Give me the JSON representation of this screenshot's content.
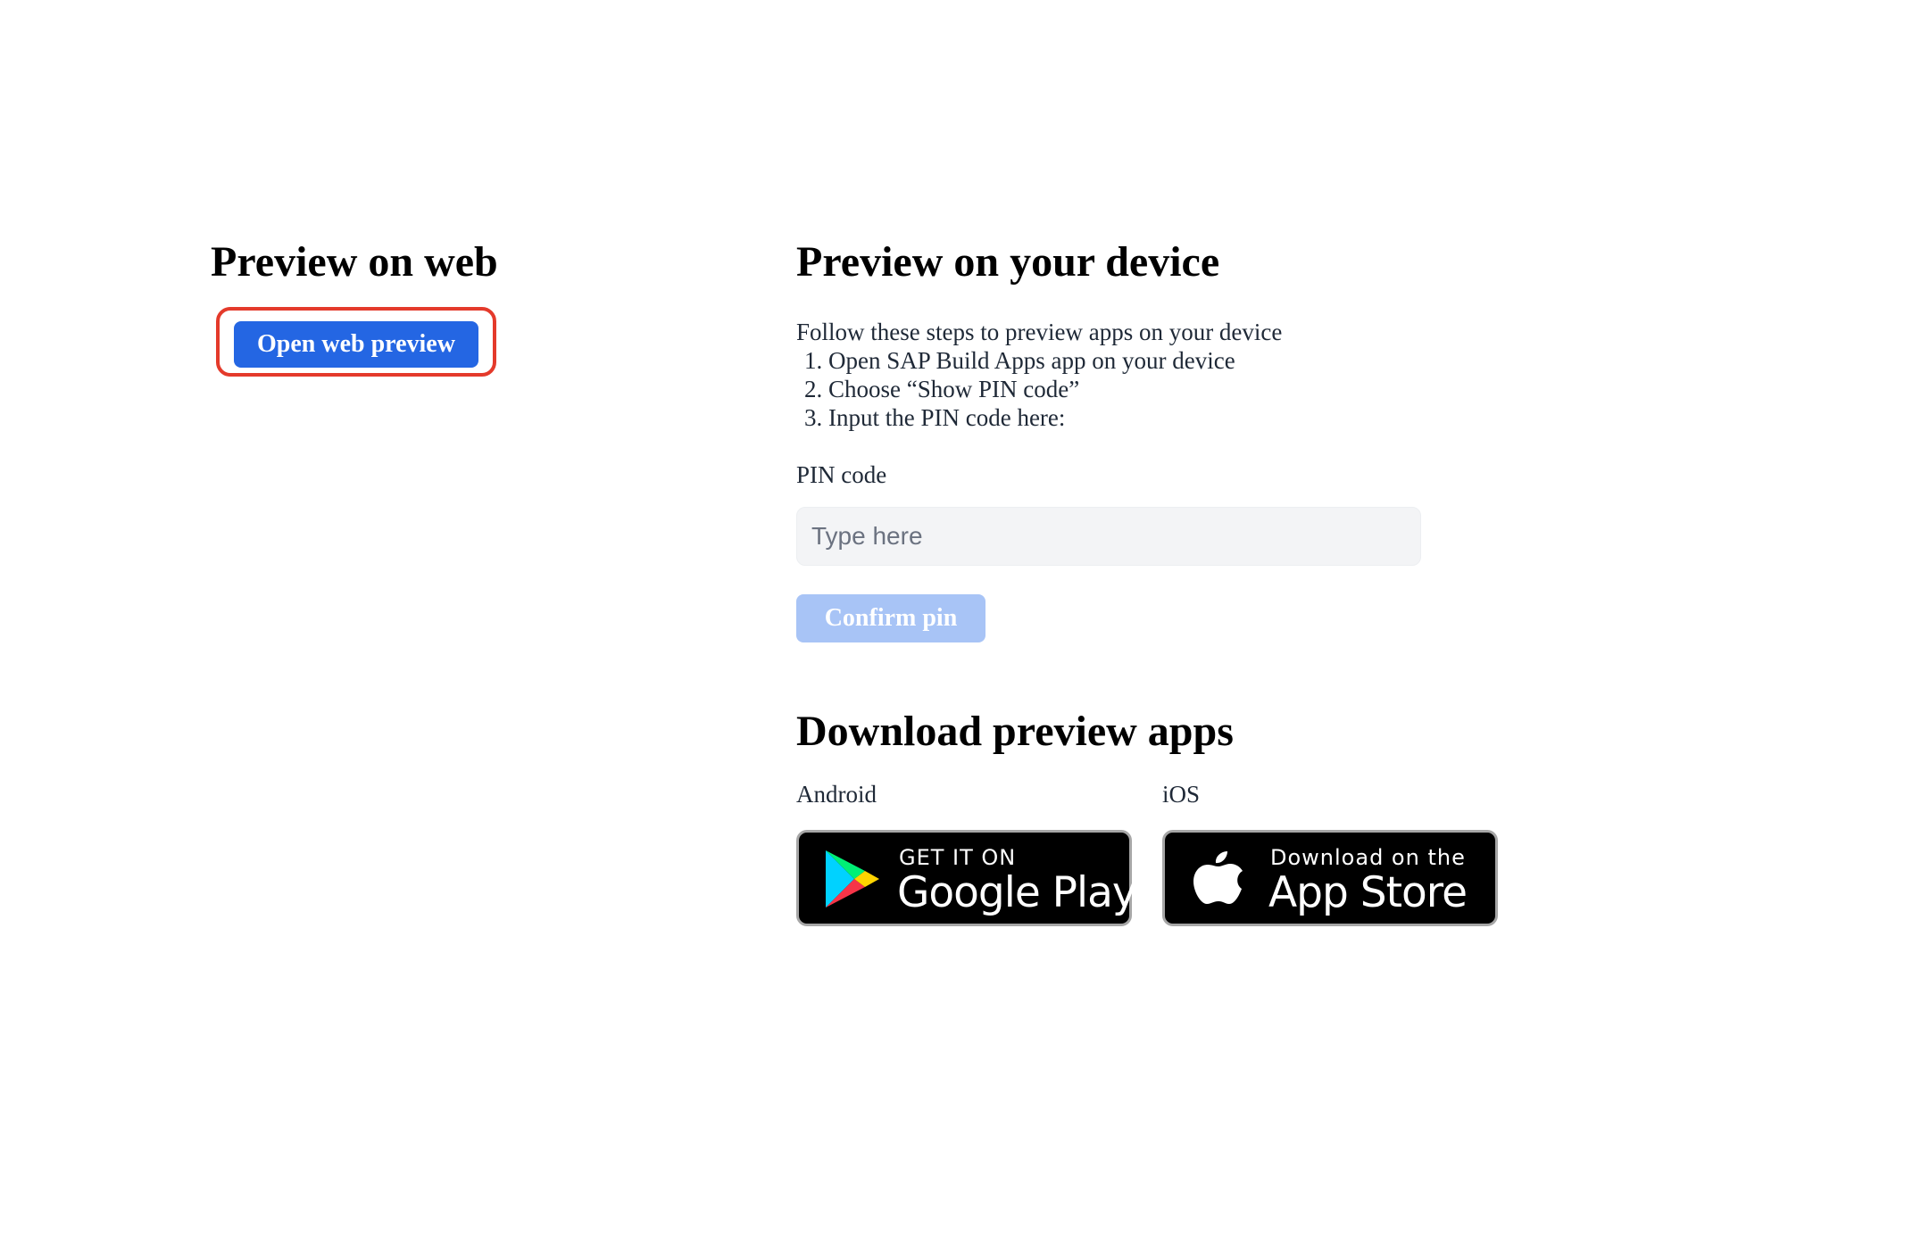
{
  "web": {
    "heading": "Preview on web",
    "open_button_label": "Open web preview"
  },
  "device": {
    "heading": "Preview on your device",
    "intro": "Follow these steps to preview apps on your device",
    "steps": [
      "Open SAP Build Apps app on your device",
      "Choose “Show PIN code”",
      "Input the PIN code here:"
    ],
    "pin_label": "PIN code",
    "pin_value": "",
    "pin_placeholder": "Type here",
    "confirm_label": "Confirm pin"
  },
  "downloads": {
    "heading": "Download preview apps",
    "android_label": "Android",
    "ios_label": "iOS",
    "google_play": {
      "small_text": "GET IT ON",
      "big_text": "Google Play",
      "icon": "google-play-icon"
    },
    "app_store": {
      "small_text": "Download on the",
      "big_text": "App Store",
      "icon": "apple-icon"
    }
  },
  "colors": {
    "primary": "#2466e3",
    "primary_disabled": "#a8c4f6",
    "highlight": "#e43a2b",
    "input_bg": "#f3f4f6",
    "badge_bg": "#000000"
  }
}
